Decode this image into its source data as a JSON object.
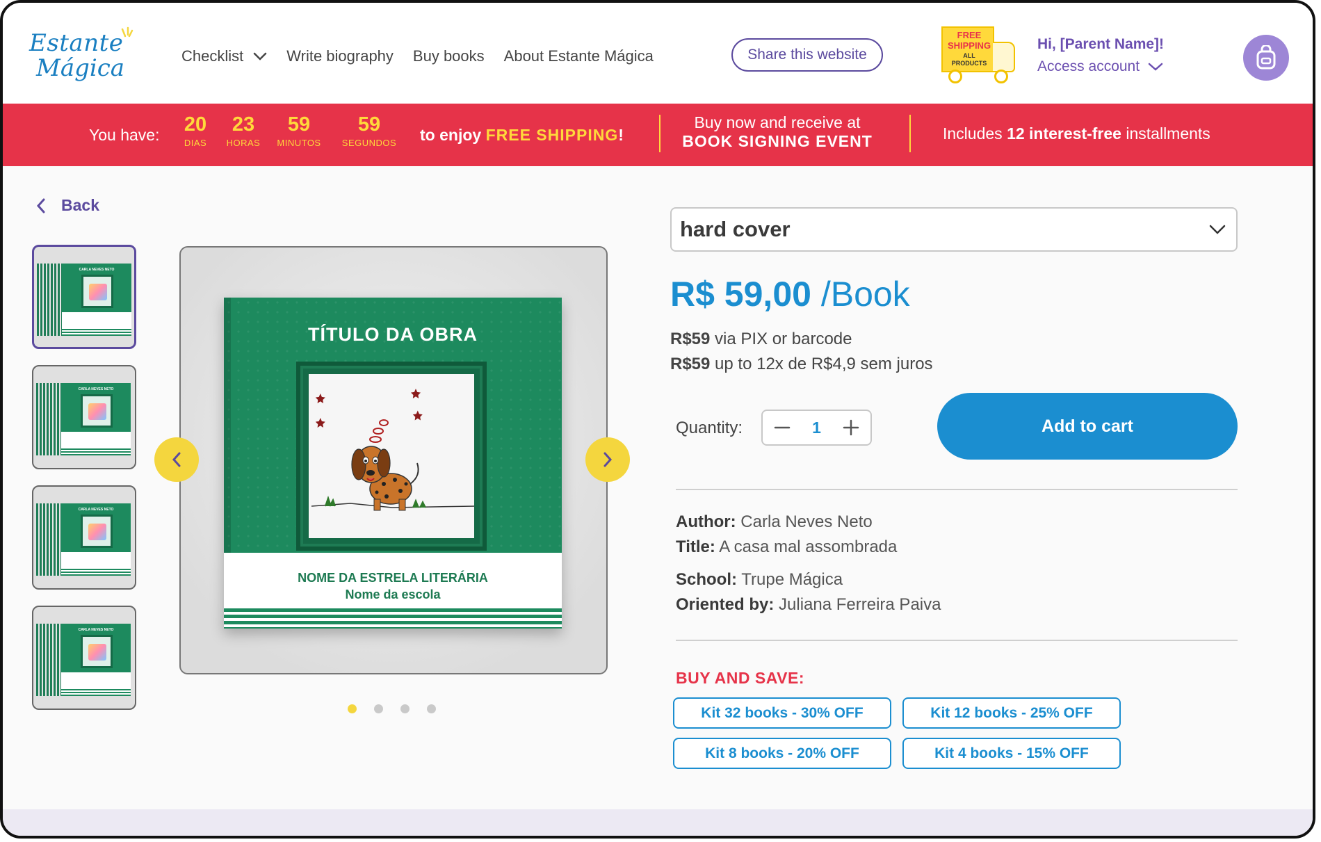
{
  "brand": {
    "logo_line1": "Estante",
    "logo_line2": "Mágica"
  },
  "nav": {
    "items": [
      {
        "label": "Checklist"
      },
      {
        "label": "Write biography"
      },
      {
        "label": "Buy books"
      },
      {
        "label": "About Estante Mágica"
      }
    ],
    "share_label": "Share this website"
  },
  "shipping_badge": {
    "line1": "FREE",
    "line2": "SHIPPING",
    "line3": "ALL",
    "line4": "PRODUCTS"
  },
  "account": {
    "greeting": "Hi, [Parent Name]!",
    "access_label": "Access account"
  },
  "banner": {
    "you_have": "You have:",
    "countdown": [
      {
        "value": "20",
        "unit": "DIAS"
      },
      {
        "value": "23",
        "unit": "HORAS"
      },
      {
        "value": "59",
        "unit": "MINUTOS"
      },
      {
        "value": "59",
        "unit": "SEGUNDOS"
      }
    ],
    "enjoy_prefix": "to enjoy ",
    "enjoy_highlight": "FREE SHIPPING",
    "enjoy_suffix": "!",
    "signing_line1": "Buy now and receive at",
    "signing_line2": "BOOK SIGNING EVENT",
    "installments_prefix": "Includes ",
    "installments_bold": "12 interest-free",
    "installments_suffix": " installments"
  },
  "back_label": "Back",
  "book": {
    "title": "TÍTULO DA OBRA",
    "star_name": "NOME DA ESTRELA LITERÁRIA",
    "school_name": "Nome da escola",
    "thumb_author": "CARLA NEVES NETO"
  },
  "gallery": {
    "thumbs": 4,
    "active_index": 0
  },
  "product": {
    "cover_option": "hard cover",
    "price_main": "R$ 59,00",
    "price_unit": " /Book",
    "pay_pix_bold": "R$59",
    "pay_pix_text": " via PIX or barcode",
    "pay_inst_bold": "R$59",
    "pay_inst_text": " up to 12x de R$4,9 sem juros",
    "quantity_label": "Quantity:",
    "quantity_value": "1",
    "add_to_cart": "Add to cart"
  },
  "details": {
    "author_label": "Author:",
    "author_value": " Carla Neves Neto",
    "title_label": "Title:",
    "title_value": " A casa mal assombrada",
    "school_label": "School:",
    "school_value": " Trupe Mágica",
    "oriented_label": "Oriented by:",
    "oriented_value": " Juliana Ferreira Paiva"
  },
  "buy_and_save": {
    "heading": "BUY AND SAVE:",
    "kits": [
      "Kit 32 books - 30% OFF",
      "Kit 12 books - 25% OFF",
      "Kit 8 books - 20% OFF",
      "Kit 4 books - 15% OFF"
    ]
  },
  "colors": {
    "primary_blue": "#1b8ed0",
    "purple": "#5b4a9e",
    "banner_red": "#e63349",
    "yellow": "#f4d63e",
    "book_green": "#1d8a5e"
  }
}
